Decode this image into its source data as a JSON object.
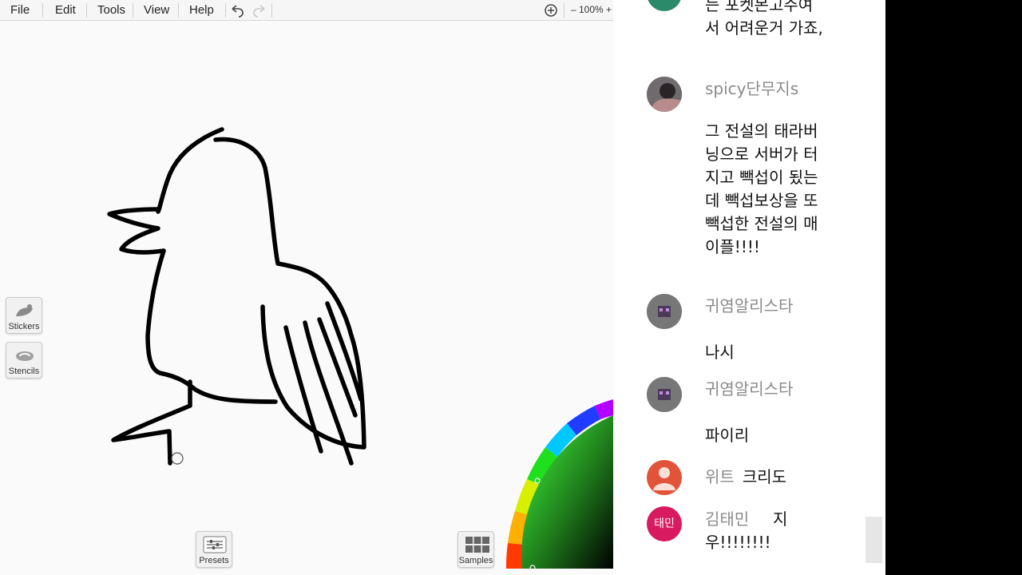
{
  "menu": {
    "file": "File",
    "edit": "Edit",
    "tools": "Tools",
    "view": "View",
    "help": "Help"
  },
  "zoom_label": "– 100% +",
  "side_tools": {
    "stickers": "Stickers",
    "stencils": "Stencils"
  },
  "bottom_tools": {
    "presets": "Presets",
    "samples": "Samples"
  },
  "chat": {
    "messages": [
      {
        "author": "",
        "text": "는 포켓몬고주여서 어려운거 가죠,"
      },
      {
        "author": "spicy단무지s",
        "text": "그 전설의 태라버닝으로 서버가 터지고 빽섭이 됬는데 빽섭보상을 또 빽섭한 전설의 매이플!!!!"
      },
      {
        "author": "귀염알리스타",
        "text": "나시"
      },
      {
        "author": "귀염알리스타",
        "text": "파이리"
      },
      {
        "author": "위트",
        "text": "크리도"
      },
      {
        "author": "김태민",
        "text": "지우!!!!!!!!",
        "avatar_text": "태민"
      }
    ]
  },
  "colors": {
    "avatar_wit": "#e2543a",
    "avatar_taemin": "#d81b60",
    "avatar_alista": "#7b7b7b"
  }
}
